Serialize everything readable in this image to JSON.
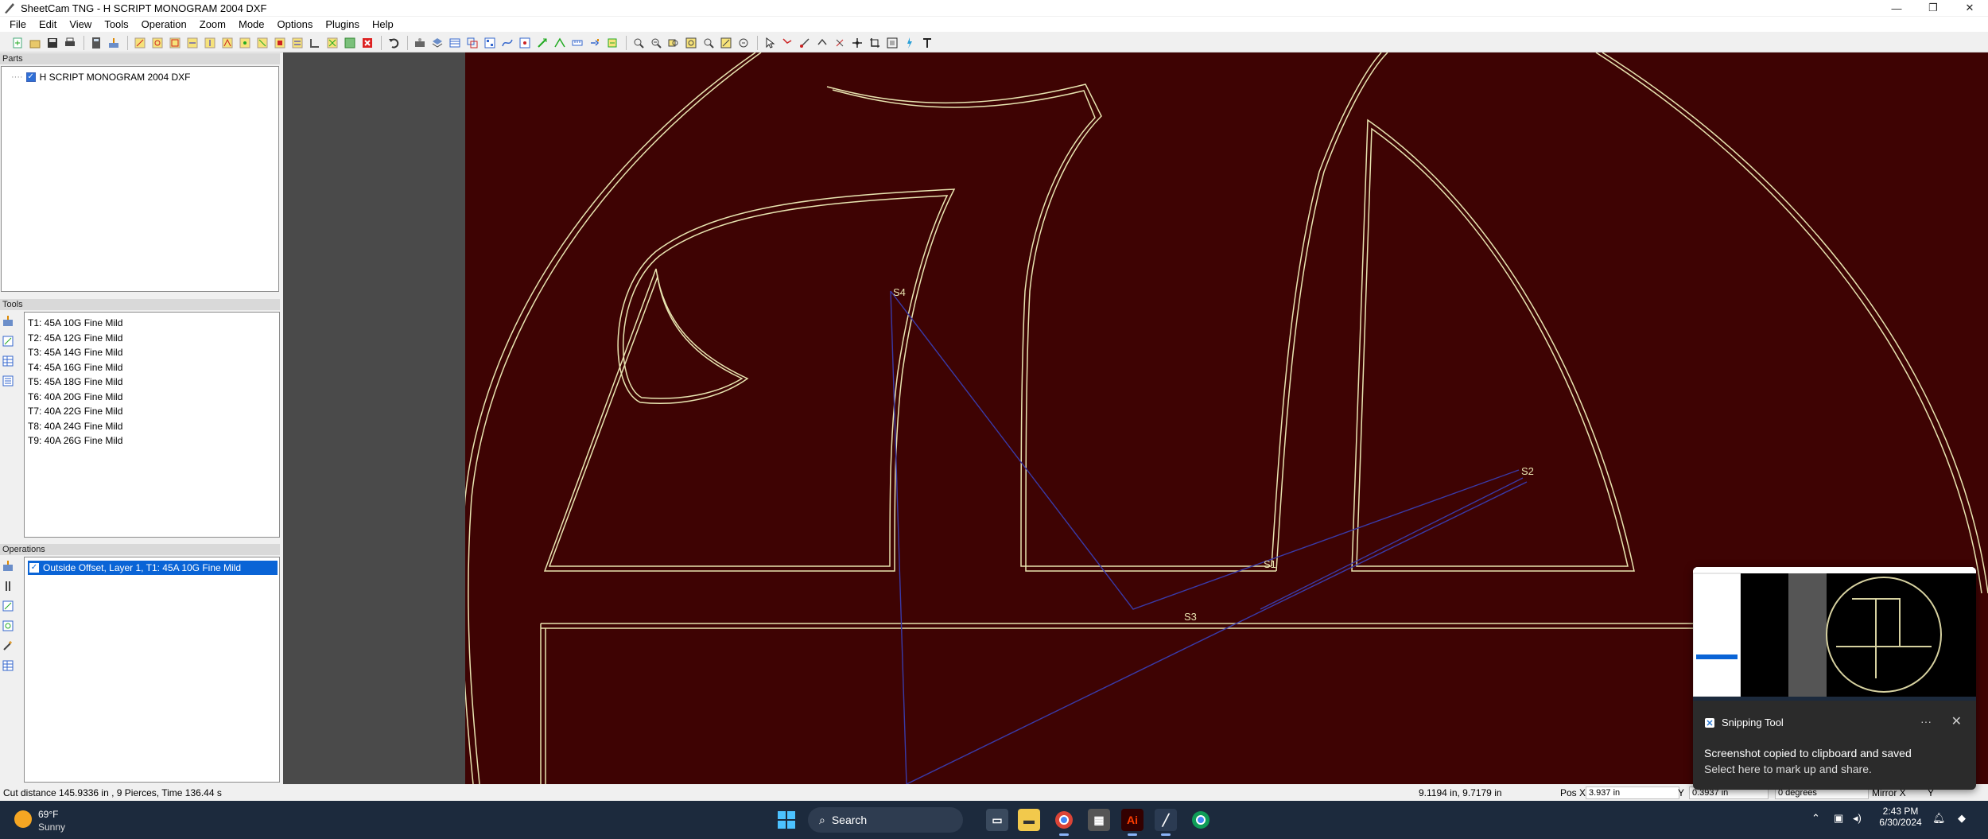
{
  "window": {
    "title": "SheetCam TNG - H SCRIPT MONOGRAM 2004 DXF",
    "controls": [
      "—",
      "❐",
      "✕"
    ]
  },
  "menu": [
    "File",
    "Edit",
    "View",
    "Tools",
    "Operation",
    "Zoom",
    "Mode",
    "Options",
    "Plugins",
    "Help"
  ],
  "parts": {
    "header": "Parts",
    "items": [
      {
        "label": "H SCRIPT MONOGRAM 2004 DXF",
        "checked": true
      }
    ]
  },
  "tools": {
    "header": "Tools",
    "items": [
      "T1: 45A 10G Fine Mild",
      "T2: 45A 12G Fine Mild",
      "T3: 45A 14G Fine Mild",
      "T4: 45A 16G Fine Mild",
      "T5: 45A 18G Fine Mild",
      "T6: 40A 20G Fine Mild",
      "T7: 40A 22G Fine Mild",
      "T8: 40A 24G Fine Mild",
      "T9: 40A 26G Fine Mild"
    ]
  },
  "operations": {
    "header": "Operations",
    "items": [
      {
        "label": "Outside Offset, Layer 1, T1: 45A 10G Fine Mild",
        "checked": true,
        "selected": true
      }
    ]
  },
  "canvas": {
    "markers": [
      "S4",
      "S2",
      "S1",
      "S3"
    ],
    "colors": {
      "background": "#3e0303",
      "outline": "#e8e4b0",
      "rapid": "#3a3aa8"
    }
  },
  "status": {
    "summary": "Cut distance 145.9336 in , 9 Pierces, Time 136.44 s",
    "coords": "9.1194 in, 9.7179 in",
    "pos_x_label": "Pos X",
    "pos_x_value": "3.937 in",
    "pos_y_label": "Y",
    "pos_y_value": "0.3937 in",
    "angle_value": "0 degrees",
    "mirror_label": "Mirror X",
    "mirror_y_label": "Y"
  },
  "toast": {
    "app": "Snipping Tool",
    "more": "···",
    "close": "✕",
    "message": "Screenshot copied to clipboard and saved",
    "sub": "Select here to mark up and share."
  },
  "taskbar": {
    "weather_temp": "69°F",
    "weather_cond": "Sunny",
    "search_placeholder": "Search",
    "time": "2:43 PM",
    "date": "6/30/2024"
  }
}
